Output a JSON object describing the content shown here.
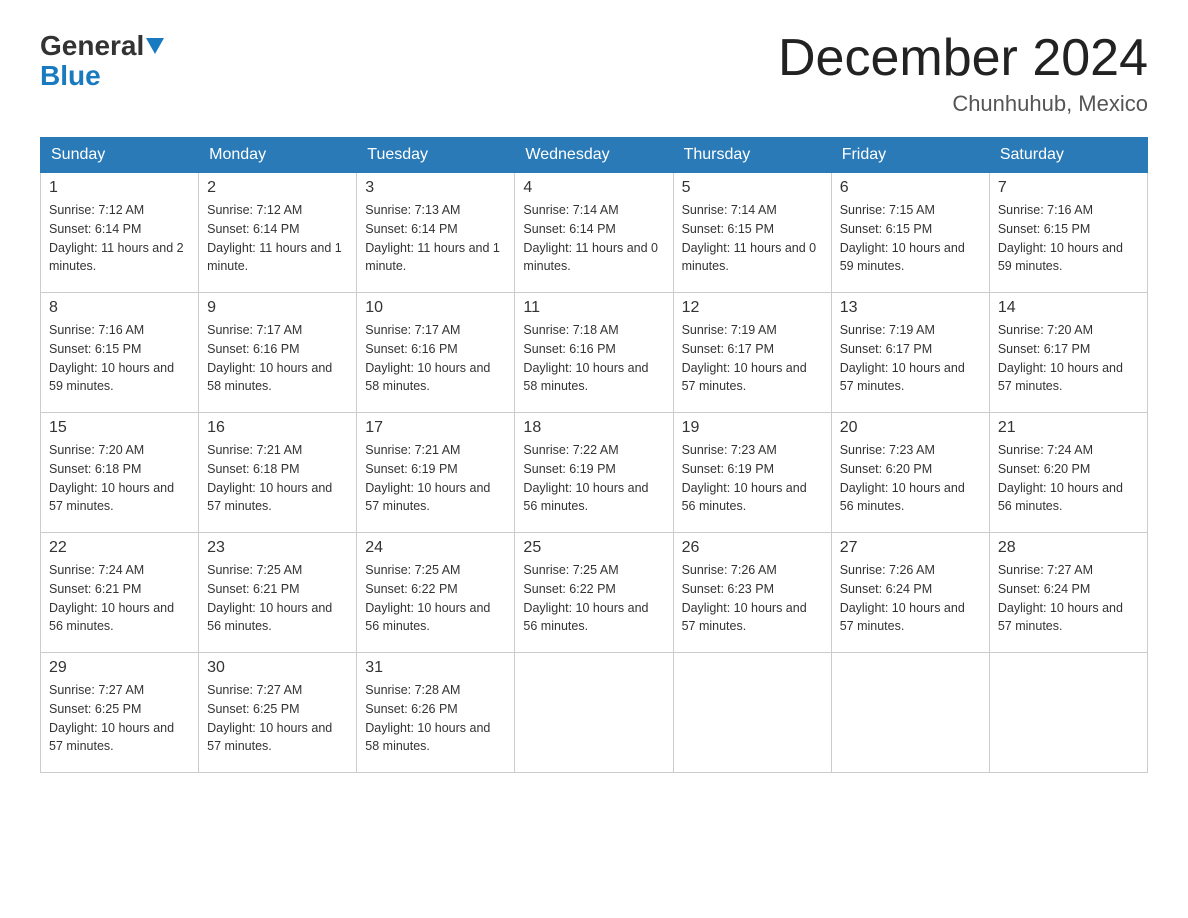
{
  "header": {
    "logo_general": "General",
    "logo_blue": "Blue",
    "month_title": "December 2024",
    "location": "Chunhuhub, Mexico"
  },
  "days_of_week": [
    "Sunday",
    "Monday",
    "Tuesday",
    "Wednesday",
    "Thursday",
    "Friday",
    "Saturday"
  ],
  "weeks": [
    [
      {
        "day": "1",
        "sunrise": "7:12 AM",
        "sunset": "6:14 PM",
        "daylight": "11 hours and 2 minutes."
      },
      {
        "day": "2",
        "sunrise": "7:12 AM",
        "sunset": "6:14 PM",
        "daylight": "11 hours and 1 minute."
      },
      {
        "day": "3",
        "sunrise": "7:13 AM",
        "sunset": "6:14 PM",
        "daylight": "11 hours and 1 minute."
      },
      {
        "day": "4",
        "sunrise": "7:14 AM",
        "sunset": "6:14 PM",
        "daylight": "11 hours and 0 minutes."
      },
      {
        "day": "5",
        "sunrise": "7:14 AM",
        "sunset": "6:15 PM",
        "daylight": "11 hours and 0 minutes."
      },
      {
        "day": "6",
        "sunrise": "7:15 AM",
        "sunset": "6:15 PM",
        "daylight": "10 hours and 59 minutes."
      },
      {
        "day": "7",
        "sunrise": "7:16 AM",
        "sunset": "6:15 PM",
        "daylight": "10 hours and 59 minutes."
      }
    ],
    [
      {
        "day": "8",
        "sunrise": "7:16 AM",
        "sunset": "6:15 PM",
        "daylight": "10 hours and 59 minutes."
      },
      {
        "day": "9",
        "sunrise": "7:17 AM",
        "sunset": "6:16 PM",
        "daylight": "10 hours and 58 minutes."
      },
      {
        "day": "10",
        "sunrise": "7:17 AM",
        "sunset": "6:16 PM",
        "daylight": "10 hours and 58 minutes."
      },
      {
        "day": "11",
        "sunrise": "7:18 AM",
        "sunset": "6:16 PM",
        "daylight": "10 hours and 58 minutes."
      },
      {
        "day": "12",
        "sunrise": "7:19 AM",
        "sunset": "6:17 PM",
        "daylight": "10 hours and 57 minutes."
      },
      {
        "day": "13",
        "sunrise": "7:19 AM",
        "sunset": "6:17 PM",
        "daylight": "10 hours and 57 minutes."
      },
      {
        "day": "14",
        "sunrise": "7:20 AM",
        "sunset": "6:17 PM",
        "daylight": "10 hours and 57 minutes."
      }
    ],
    [
      {
        "day": "15",
        "sunrise": "7:20 AM",
        "sunset": "6:18 PM",
        "daylight": "10 hours and 57 minutes."
      },
      {
        "day": "16",
        "sunrise": "7:21 AM",
        "sunset": "6:18 PM",
        "daylight": "10 hours and 57 minutes."
      },
      {
        "day": "17",
        "sunrise": "7:21 AM",
        "sunset": "6:19 PM",
        "daylight": "10 hours and 57 minutes."
      },
      {
        "day": "18",
        "sunrise": "7:22 AM",
        "sunset": "6:19 PM",
        "daylight": "10 hours and 56 minutes."
      },
      {
        "day": "19",
        "sunrise": "7:23 AM",
        "sunset": "6:19 PM",
        "daylight": "10 hours and 56 minutes."
      },
      {
        "day": "20",
        "sunrise": "7:23 AM",
        "sunset": "6:20 PM",
        "daylight": "10 hours and 56 minutes."
      },
      {
        "day": "21",
        "sunrise": "7:24 AM",
        "sunset": "6:20 PM",
        "daylight": "10 hours and 56 minutes."
      }
    ],
    [
      {
        "day": "22",
        "sunrise": "7:24 AM",
        "sunset": "6:21 PM",
        "daylight": "10 hours and 56 minutes."
      },
      {
        "day": "23",
        "sunrise": "7:25 AM",
        "sunset": "6:21 PM",
        "daylight": "10 hours and 56 minutes."
      },
      {
        "day": "24",
        "sunrise": "7:25 AM",
        "sunset": "6:22 PM",
        "daylight": "10 hours and 56 minutes."
      },
      {
        "day": "25",
        "sunrise": "7:25 AM",
        "sunset": "6:22 PM",
        "daylight": "10 hours and 56 minutes."
      },
      {
        "day": "26",
        "sunrise": "7:26 AM",
        "sunset": "6:23 PM",
        "daylight": "10 hours and 57 minutes."
      },
      {
        "day": "27",
        "sunrise": "7:26 AM",
        "sunset": "6:24 PM",
        "daylight": "10 hours and 57 minutes."
      },
      {
        "day": "28",
        "sunrise": "7:27 AM",
        "sunset": "6:24 PM",
        "daylight": "10 hours and 57 minutes."
      }
    ],
    [
      {
        "day": "29",
        "sunrise": "7:27 AM",
        "sunset": "6:25 PM",
        "daylight": "10 hours and 57 minutes."
      },
      {
        "day": "30",
        "sunrise": "7:27 AM",
        "sunset": "6:25 PM",
        "daylight": "10 hours and 57 minutes."
      },
      {
        "day": "31",
        "sunrise": "7:28 AM",
        "sunset": "6:26 PM",
        "daylight": "10 hours and 58 minutes."
      },
      null,
      null,
      null,
      null
    ]
  ]
}
